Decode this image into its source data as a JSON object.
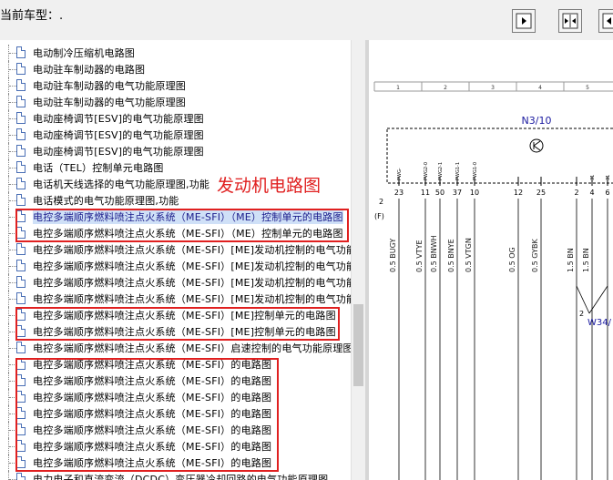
{
  "header": {
    "title": "当前车型：."
  },
  "tree": {
    "items": [
      "电动制冷压缩机电路图",
      "电动驻车制动器的电路图",
      "电动驻车制动器的电气功能原理图",
      "电动驻车制动器的电气功能原理图",
      "电动座椅调节[ESV]的电气功能原理图",
      "电动座椅调节[ESV]的电气功能原理图",
      "电动座椅调节[ESV]的电气功能原理图",
      "电话（TEL）控制单元电路图",
      "电话机天线选择的电气功能原理图,功能",
      "电话模式的电气功能原理图,功能",
      "电控多端顺序燃料喷注点火系统（ME-SFI）（ME）控制单元的电路图",
      "电控多端顺序燃料喷注点火系统（ME-SFI）（ME）控制单元的电路图",
      "电控多端顺序燃料喷注点火系统（ME-SFI）[ME]发动机控制的电气功能",
      "电控多端顺序燃料喷注点火系统（ME-SFI）[ME]发动机控制的电气功能",
      "电控多端顺序燃料喷注点火系统（ME-SFI）[ME]发动机控制的电气功能",
      "电控多端顺序燃料喷注点火系统（ME-SFI）[ME]发动机控制的电气功能",
      "电控多端顺序燃料喷注点火系统（ME-SFI）[ME]控制单元的电路图",
      "电控多端顺序燃料喷注点火系统（ME-SFI）[ME]控制单元的电路图",
      "电控多端顺序燃料喷注点火系统（ME-SFI）启速控制的电气功能原理图",
      "电控多端顺序燃料喷注点火系统（ME-SFI）的电路图",
      "电控多端顺序燃料喷注点火系统（ME-SFI）的电路图",
      "电控多端顺序燃料喷注点火系统（ME-SFI）的电路图",
      "电控多端顺序燃料喷注点火系统（ME-SFI）的电路图",
      "电控多端顺序燃料喷注点火系统（ME-SFI）的电路图",
      "电控多端顺序燃料喷注点火系统（ME-SFI）的电路图",
      "电控多端顺序燃料喷注点火系统（ME-SFI）的电路图",
      "电力电子和直流变流（DCDC）变压器冷却回路的电气功能原理图"
    ],
    "selected_index": 10
  },
  "annotation": "发动机电路图",
  "diagram": {
    "columns": [
      "1",
      "2",
      "3",
      "4",
      "5"
    ],
    "component": "N3/10",
    "side_number": "2",
    "side_label": "(F)",
    "pin_labels": [
      "PWG-",
      "PWG2-0",
      "PWG2-1",
      "PWG1-1",
      "PWG1-0",
      "",
      "",
      "",
      "31",
      "31"
    ],
    "pin_numbers": [
      "23",
      "11",
      "50",
      "37",
      "10",
      "12",
      "25",
      "2",
      "4",
      "6"
    ],
    "wires": [
      "0.5 BUGY",
      "0.5 VTYE",
      "0.5 BNWH",
      "0.5 BNYE",
      "0.5 VTGN",
      "0.5 OG",
      "0.5 GYBK",
      "1.5 BN",
      "1.5 BN"
    ],
    "ground": "W34/",
    "ground_number": "2",
    "colors": {
      "wire_label": "#1a1a1a",
      "component": "#1a1aa0",
      "red_box": "#e02020"
    }
  }
}
